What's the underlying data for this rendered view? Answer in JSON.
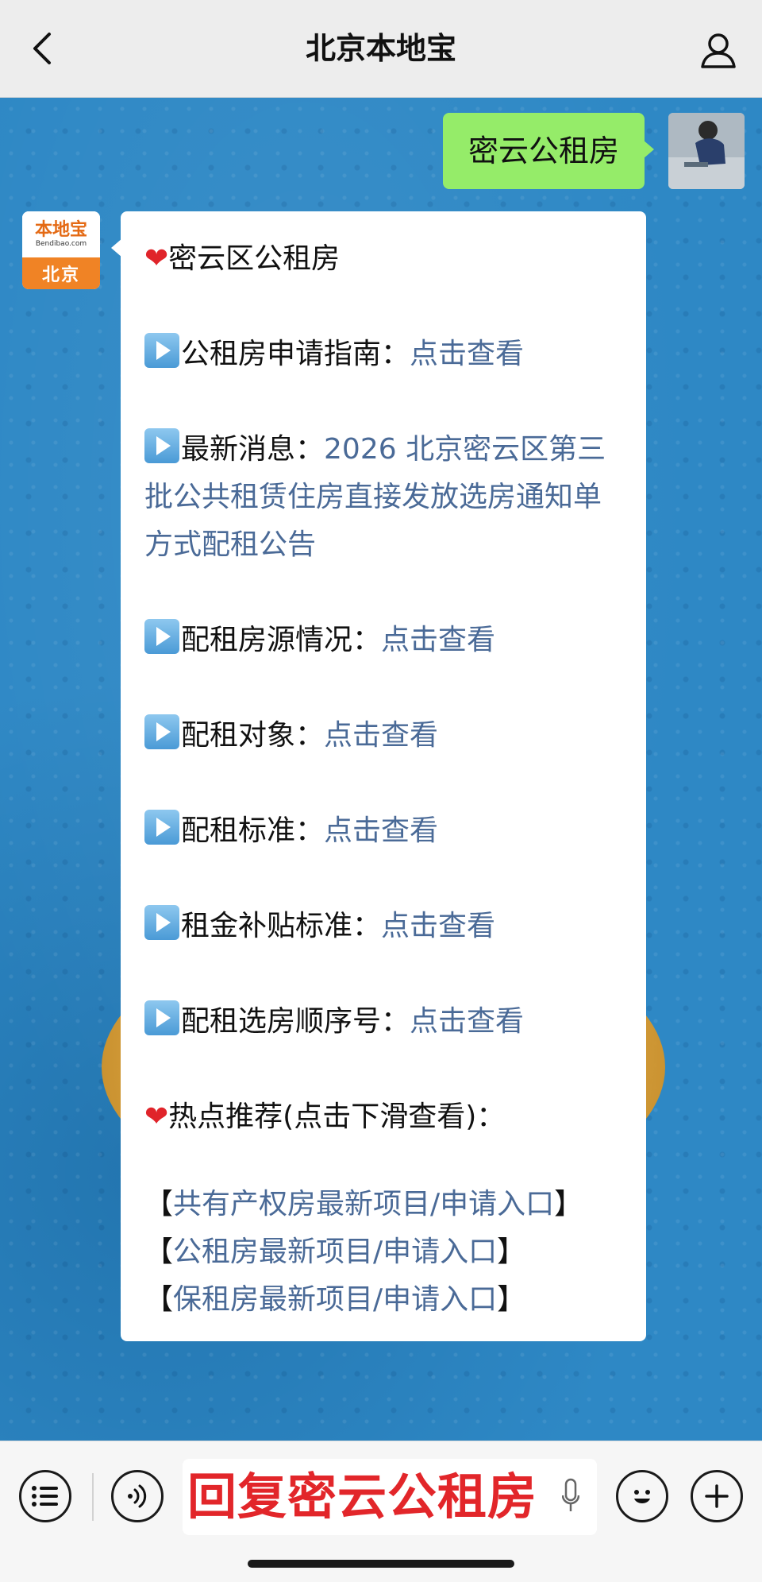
{
  "header": {
    "title": "北京本地宝"
  },
  "user_message": {
    "text": "密云公租房"
  },
  "bot": {
    "avatar": {
      "brand": "本地宝",
      "site": "Bendibao.com",
      "city": "北京"
    },
    "title": "密云区公租房",
    "items": [
      {
        "label": "公租房申请指南：",
        "link": "点击查看"
      },
      {
        "label": "最新消息：",
        "link": "2026 北京密云区第三批公共租赁住房直接发放选房通知单方式配租公告"
      },
      {
        "label": "配租房源情况：",
        "link": "点击查看"
      },
      {
        "label": "配租对象：",
        "link": "点击查看"
      },
      {
        "label": "配租标准：",
        "link": "点击查看"
      },
      {
        "label": "租金补贴标准：",
        "link": "点击查看"
      },
      {
        "label": "配租选房顺序号：",
        "link": "点击查看"
      }
    ],
    "hot_title": "热点推荐(点击下滑查看)：",
    "hot_links": [
      "共有产权房最新项目/申请入口",
      "公租房最新项目/申请入口",
      "保租房最新项目/申请入口"
    ]
  },
  "input": {
    "overlay_text": "回复密云公租房"
  },
  "icons": {
    "back": "chevron-left-icon",
    "profile": "person-icon",
    "menu": "list-icon",
    "voice": "voice-icon",
    "emoji": "emoji-icon",
    "plus": "plus-icon"
  },
  "colors": {
    "user_bubble": "#95ec69",
    "link": "#4a6a97",
    "chat_bg": "#2e88c5",
    "overlay_text": "#e2262a"
  }
}
